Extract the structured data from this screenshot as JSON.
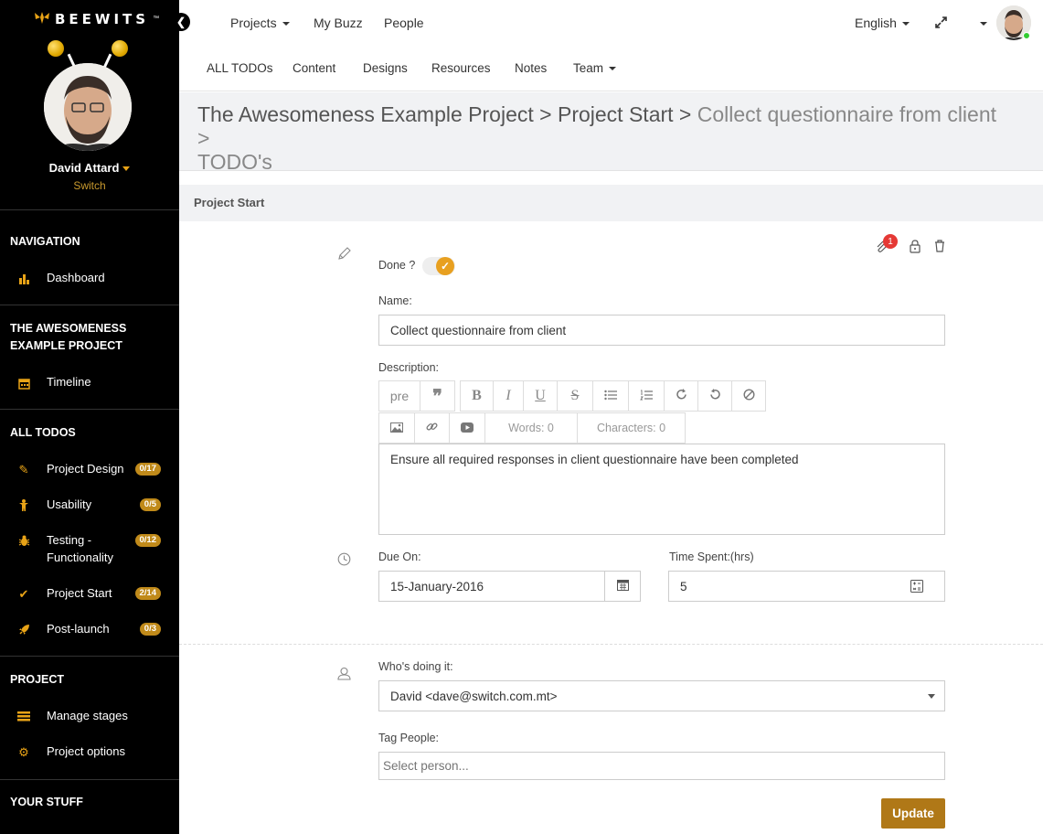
{
  "sidebar": {
    "logo_text": "BEEWITS",
    "logo_tm": "™",
    "user": {
      "name": "David Attard",
      "switch_label": "Switch"
    },
    "sections": {
      "navigation": "NAVIGATION",
      "project_name": "THE AWESOMENESS EXAMPLE PROJECT",
      "all_todos": "ALL TODOS",
      "project": "PROJECT",
      "your_stuff": "YOUR STUFF"
    },
    "items": {
      "dashboard": "Dashboard",
      "timeline": "Timeline",
      "project_design": {
        "label": "Project Design",
        "badge": "0/17"
      },
      "usability": {
        "label": "Usability",
        "badge": "0/5"
      },
      "testing": {
        "label": "Testing - Functionality",
        "badge": "0/12"
      },
      "project_start": {
        "label": "Project Start",
        "badge": "2/14"
      },
      "post_launch": {
        "label": "Post-launch",
        "badge": "0/3"
      },
      "manage_stages": "Manage stages",
      "project_options": "Project options"
    },
    "accent_color": "#e8a317"
  },
  "topbar": {
    "nav": {
      "projects": "Projects",
      "my_buzz": "My Buzz",
      "people": "People"
    },
    "language": "English",
    "subnav": {
      "all_todos": "ALL TODOs",
      "content": "Content",
      "designs": "Designs",
      "resources": "Resources",
      "notes": "Notes",
      "team": "Team"
    }
  },
  "breadcrumb": {
    "project": "The Awesomeness Example Project",
    "sep1": " > ",
    "stage": "Project Start",
    "sep2": " > ",
    "current": "Collect questionnaire from client >",
    "todos": "TODO's"
  },
  "section_title": "Project Start",
  "form": {
    "notification_count": "1",
    "done_label": "Done ?",
    "name_label": "Name:",
    "name_value": "Collect questionnaire from client",
    "description_label": "Description:",
    "toolbar": {
      "pre": "pre",
      "words": "Words: 0",
      "characters": "Characters: 0"
    },
    "description_value": "Ensure all required responses in client questionnaire have been completed",
    "due_label": "Due On:",
    "due_value": "15-January-2016",
    "time_label": "Time Spent:(hrs)",
    "time_value": "5",
    "who_label": "Who's doing it:",
    "who_value": "David <dave@switch.com.mt>",
    "tag_label": "Tag People:",
    "tag_placeholder": "Select person...",
    "update_label": "Update"
  }
}
